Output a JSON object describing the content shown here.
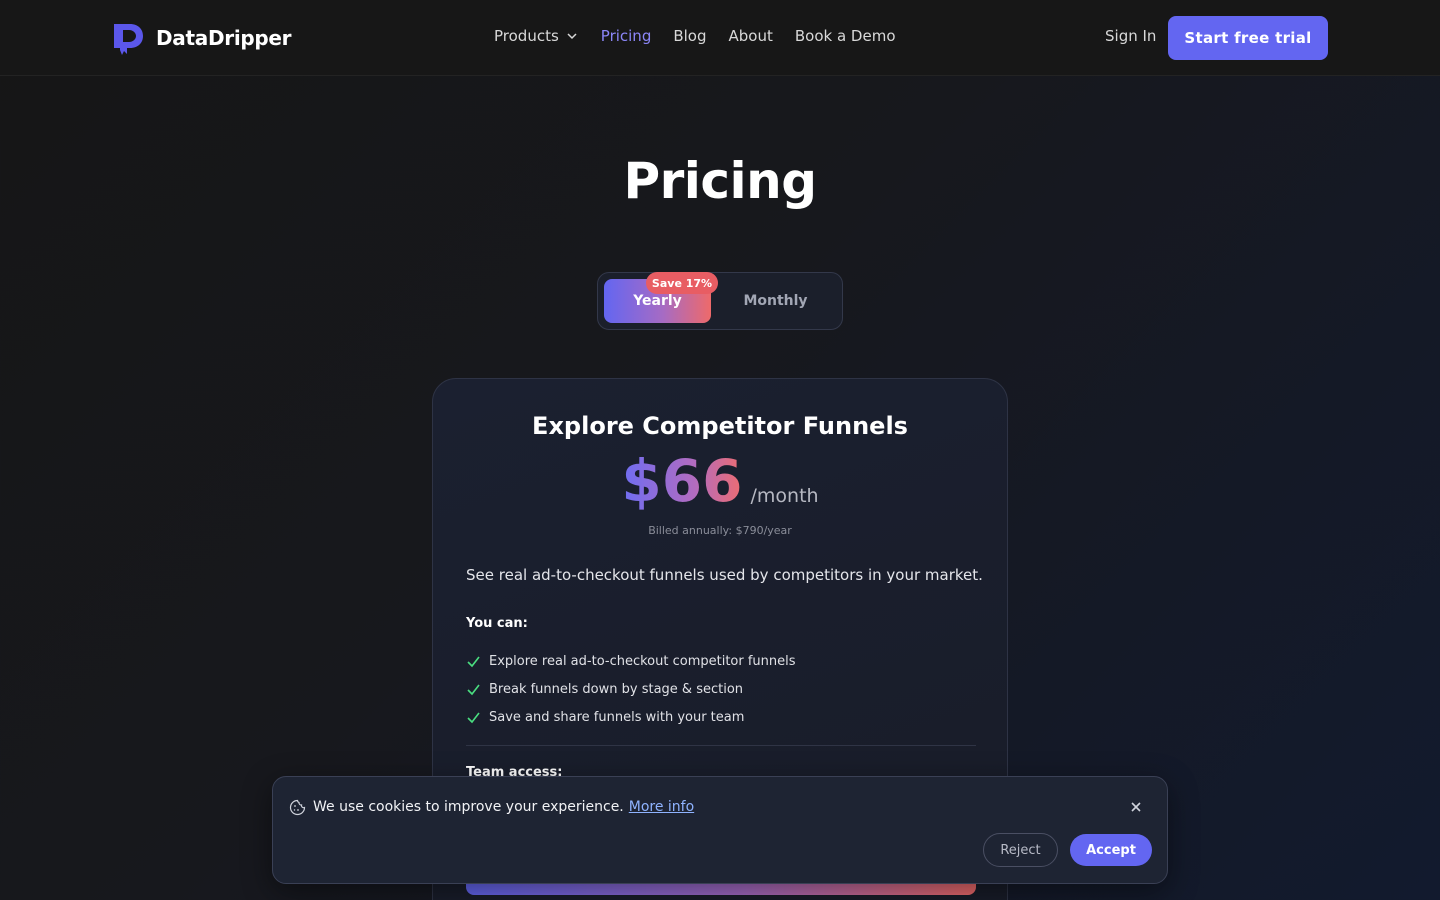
{
  "nav": {
    "brand": "DataDripper",
    "links": {
      "products": "Products",
      "pricing": "Pricing",
      "blog": "Blog",
      "about": "About",
      "demo": "Book a Demo"
    },
    "sign_in": "Sign In",
    "trial_button": "Start free trial"
  },
  "page": {
    "title": "Pricing"
  },
  "billing_toggle": {
    "yearly": "Yearly",
    "monthly": "Monthly",
    "badge": "Save 17%",
    "selected": "Yearly"
  },
  "plan": {
    "title": "Explore Competitor Funnels",
    "price": "$66",
    "period": "/month",
    "billed": "Billed annually: $790/year",
    "description": "See real ad-to-checkout funnels used by competitors in your market.",
    "you_can_heading": "You can:",
    "features": [
      "Explore real ad-to-checkout competitor funnels",
      "Break funnels down by stage & section",
      "Save and share funnels with your team"
    ],
    "team_heading": "Team access:"
  },
  "cookie_banner": {
    "message": "We use cookies to improve your experience.",
    "link": "More info",
    "reject": "Reject",
    "accept": "Accept"
  },
  "colors": {
    "accent": "#6366f1",
    "active_link": "#8b86f7",
    "gradient_end": "#ee6a6a",
    "check": "#4ade80"
  }
}
